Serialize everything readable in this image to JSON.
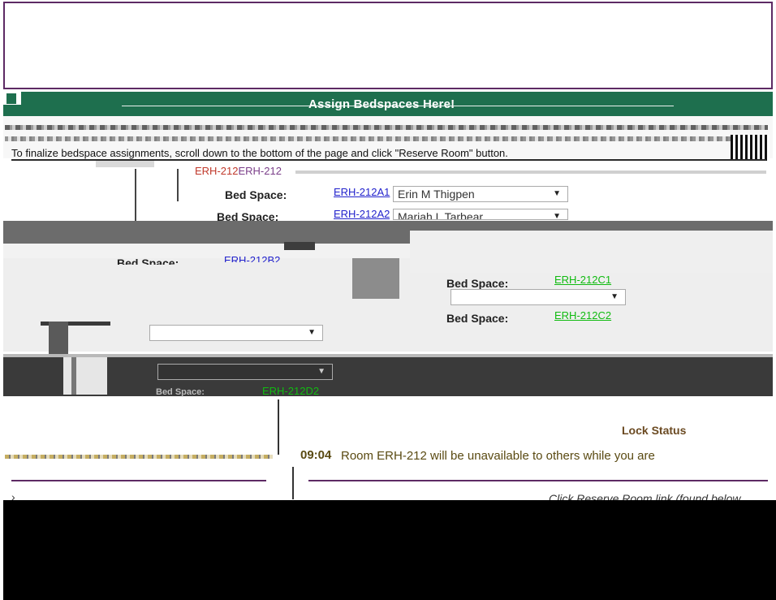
{
  "header": {
    "title": "Assign Bedspaces Here!"
  },
  "instructions": {
    "text": "To finalize bedspace assignments, scroll down to the bottom of the page and click \"Reserve Room\" button."
  },
  "room": {
    "code_a": "ERH-212",
    "code_b": "ERH-212"
  },
  "bedspaces": [
    {
      "label": "Bed Space:",
      "link": "ERH-212A1",
      "occupant": "Erin M Thigpen"
    },
    {
      "label": "Bed Space:",
      "link": "ERH-212A2",
      "occupant": "Mariah L Tarbear"
    },
    {
      "label": "Bed Space:",
      "link": "ERH-212B2"
    },
    {
      "label": "Bed Space:",
      "link": "ERH-212C1"
    },
    {
      "label": "Bed Space:",
      "link": "ERH-212C2"
    },
    {
      "label": "Bed Space:",
      "link": "ERH-212D2"
    }
  ],
  "select_arrow": "▼",
  "status": {
    "lock_title": "Lock Status",
    "timer": "09:04",
    "message": "Room ERH-212 will be unavailable to others while you are",
    "hint": "Click Reserve Room link (found below",
    "chevron": "›"
  },
  "colors": {
    "header_green": "#1e6f4e",
    "frame_purple": "#5d2a64",
    "link_blue": "#2222cc",
    "link_green": "#11bb11",
    "status_brown": "#5a4a12"
  }
}
